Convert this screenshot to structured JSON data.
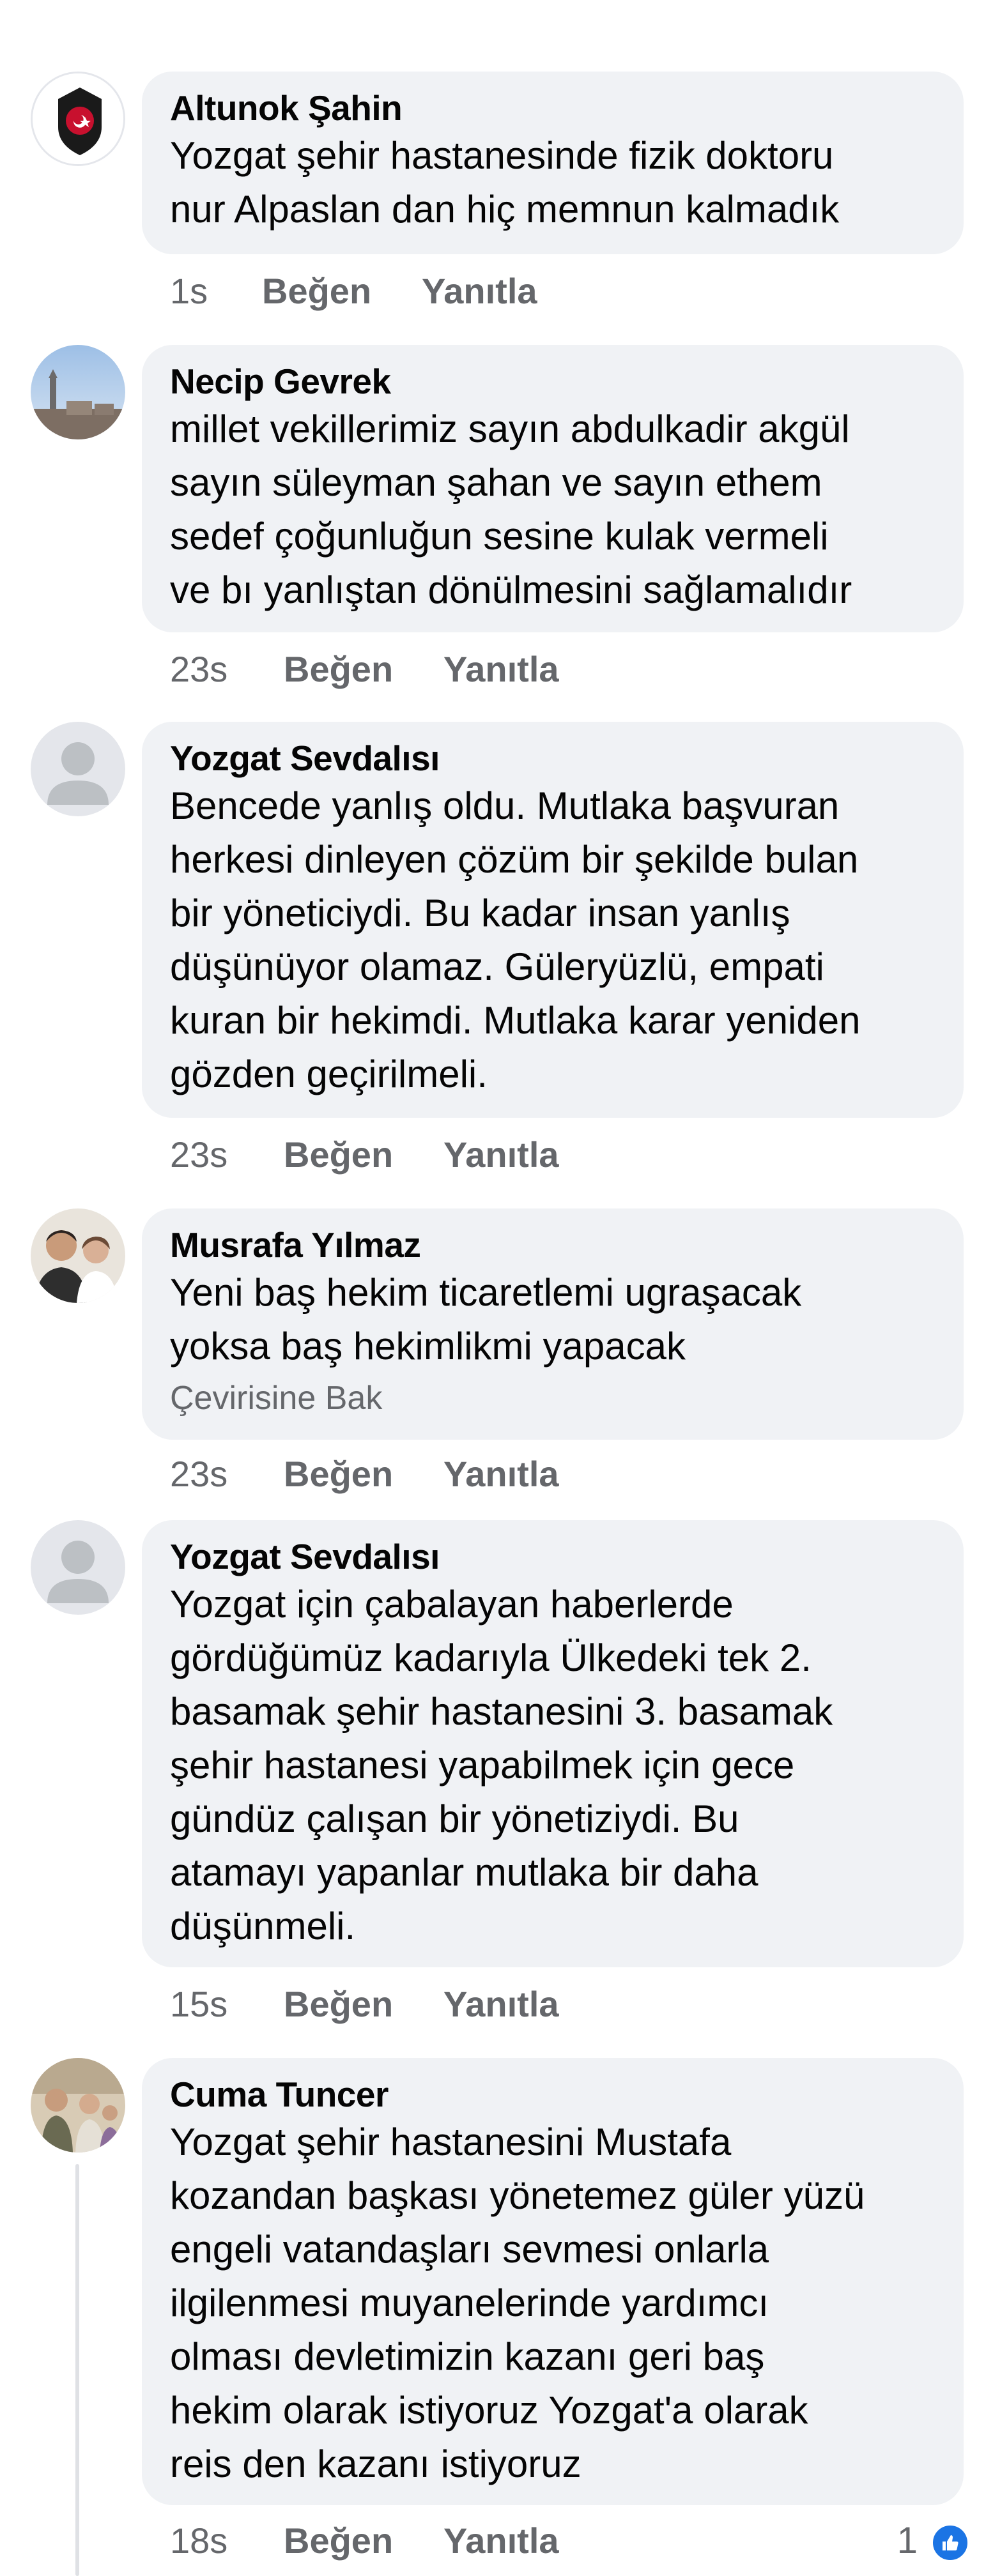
{
  "comments": [
    {
      "author": "Altunok Şahin",
      "avatar_icon": "police-emblem-icon",
      "text": "Yozgat şehir hastanesinde fizik doktoru\nnur Alpaslan dan  hiç memnun kalmadık",
      "time": "1s",
      "like_label": "Beğen",
      "reply_label": "Yanıtla"
    },
    {
      "author": "Necip Gevrek",
      "avatar_icon": "landscape-photo-avatar",
      "text": "millet vekillerimiz sayın abdulkadir akgül\nsayın süleyman şahan ve sayın ethem\nsedef çoğunluğun sesine kulak vermeli\nve bı yanlıştan dönülmesini sağlamalıdır",
      "time": "23s",
      "like_label": "Beğen",
      "reply_label": "Yanıtla"
    },
    {
      "author": "Yozgat Sevdalısı",
      "avatar_icon": "default-user-icon",
      "text": "Bencede yanlış oldu. Mutlaka başvuran\nherkesi dinleyen çözüm bir şekilde bulan\nbir yöneticiydi. Bu kadar insan yanlış\ndüşünüyor olamaz. Güleryüzlü, empati\nkuran bir hekimdi. Mutlaka karar yeniden\ngözden geçirilmeli.",
      "time": "23s",
      "like_label": "Beğen",
      "reply_label": "Yanıtla"
    },
    {
      "author": "Musrafa Yılmaz",
      "avatar_icon": "two-people-photo-avatar",
      "text": "Yeni baş hekim ticaretlemi ugraşacak\nyoksa baş hekimlikmi yapacak",
      "translate_label": "Çevirisine Bak",
      "time": "23s",
      "like_label": "Beğen",
      "reply_label": "Yanıtla"
    },
    {
      "author": "Yozgat Sevdalısı",
      "avatar_icon": "default-user-icon",
      "text": "Yozgat için çabalayan haberlerde\ngördüğümüz kadarıyla Ülkedeki tek 2.\nbasamak şehir hastanesini 3. basamak\nşehir hastanesi yapabilmek için gece\ngündüz çalışan bir yönetiziydi. Bu\natamayı yapanlar mutlaka bir daha\ndüşünmeli.",
      "time": "15s",
      "like_label": "Beğen",
      "reply_label": "Yanıtla"
    },
    {
      "author": "Cuma Tuncer",
      "avatar_icon": "family-photo-avatar",
      "text": "Yozgat şehir hastanesini Mustafa\nkozandan başkası yönetemez güler yüzü\nengeli vatandaşları sevmesi onlarla\nilgilenmesi muyanelerinde yardımcı\nolması devletimizin kazanı geri baş\nhekim olarak istiyoruz Yozgat'a olarak\nreis den kazanı istiyoruz",
      "time": "18s",
      "like_label": "Beğen",
      "reply_label": "Yanıtla",
      "reaction_count": "1",
      "reaction_icon": "like-thumb-icon"
    }
  ],
  "colors": {
    "bubble": "#f0f2f5",
    "meta_text": "#65676b",
    "like_blue": "#1b74e4"
  }
}
